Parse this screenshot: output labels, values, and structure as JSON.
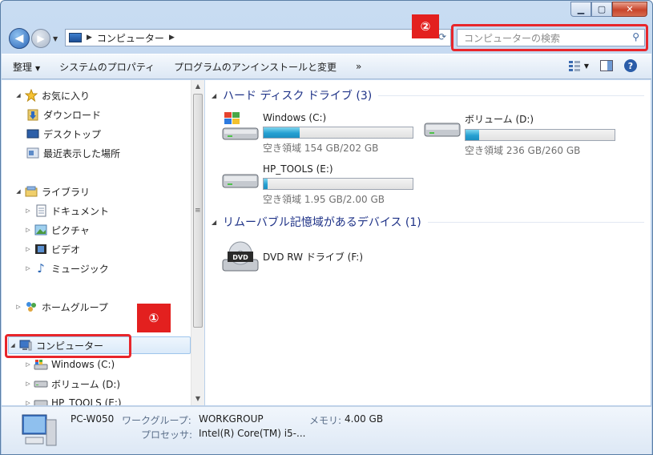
{
  "address": {
    "location": "コンピューター"
  },
  "search": {
    "placeholder": "コンピューターの検索"
  },
  "annotations": {
    "one": "①",
    "two": "②"
  },
  "toolbar": {
    "organize": "整理",
    "system_properties": "システムのプロパティ",
    "uninstall": "プログラムのアンインストールと変更",
    "more": "»"
  },
  "sidebar": {
    "favorites": "お気に入り",
    "downloads": "ダウンロード",
    "desktop": "デスクトップ",
    "recent": "最近表示した場所",
    "libraries": "ライブラリ",
    "documents": "ドキュメント",
    "pictures": "ピクチャ",
    "videos": "ビデオ",
    "music": "ミュージック",
    "homegroup": "ホームグループ",
    "computer": "コンピューター",
    "windows_c": "Windows (C:)",
    "volume_d": "ボリューム (D:)",
    "hp_tools": "HP_TOOLS (E:)"
  },
  "main": {
    "hdd_group": "ハード ディスク ドライブ (3)",
    "removable_group": "リムーバブル記憶域があるデバイス (1)",
    "drives": [
      {
        "name": "Windows (C:)",
        "free": "空き領域 154 GB/202 GB",
        "used_fraction": 0.24
      },
      {
        "name": "ボリューム (D:)",
        "free": "空き領域 236 GB/260 GB",
        "used_fraction": 0.09
      },
      {
        "name": "HP_TOOLS (E:)",
        "free": "空き領域 1.95 GB/2.00 GB",
        "used_fraction": 0.025
      }
    ],
    "dvd": {
      "name": "DVD RW ドライブ (F:)",
      "icon_label": "DVD"
    }
  },
  "status": {
    "pc_name": "PC-W050",
    "workgroup_label": "ワークグループ:",
    "workgroup": "WORKGROUP",
    "memory_label": "メモリ:",
    "memory": "4.00 GB",
    "processor_label": "プロセッサ:",
    "processor": "Intel(R) Core(TM) i5-..."
  }
}
